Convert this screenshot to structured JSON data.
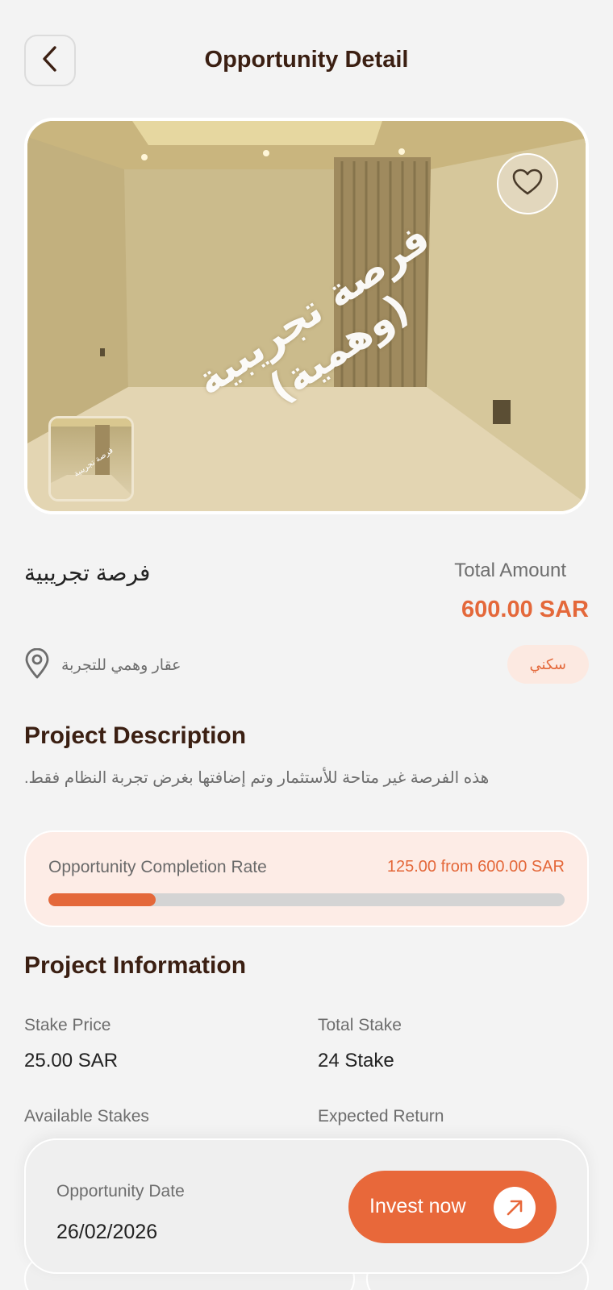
{
  "header": {
    "title": "Opportunity Detail",
    "back_icon": "chevron-left-icon"
  },
  "gallery": {
    "watermark": "فرصة تجريبية (وهمية)",
    "favorite_icon": "heart-icon"
  },
  "summary": {
    "opportunity_name": "فرصة تجريبية",
    "total_amount_label": "Total Amount",
    "total_amount_value": "600.00 SAR",
    "location_icon": "map-pin-icon",
    "location_text": "عقار وهمي للتجربة",
    "category_tag": "سكني"
  },
  "description": {
    "title": "Project Description",
    "text": "هذه الفرصة غير متاحة للأستثمار وتم إضافتها بغرض تجربة النظام فقط."
  },
  "progress": {
    "label": "Opportunity Completion Rate",
    "amount_text": "125.00 from 600.00 SAR",
    "fraction": 0.2083
  },
  "project_info": {
    "title": "Project Information",
    "stake_price_label": "Stake Price",
    "stake_price_value": "25.00 SAR",
    "total_stake_label": "Total Stake",
    "total_stake_value": "24 Stake",
    "available_stakes_label": "Available Stakes",
    "expected_return_label": "Expected Return"
  },
  "bottom_bar": {
    "date_label": "Opportunity Date",
    "date_value": "26/02/2026",
    "invest_label": "Invest now",
    "invest_icon": "arrow-up-right-icon"
  },
  "colors": {
    "accent": "#e8683a",
    "title": "#3b1f12",
    "tag_bg": "#fce9e1"
  }
}
